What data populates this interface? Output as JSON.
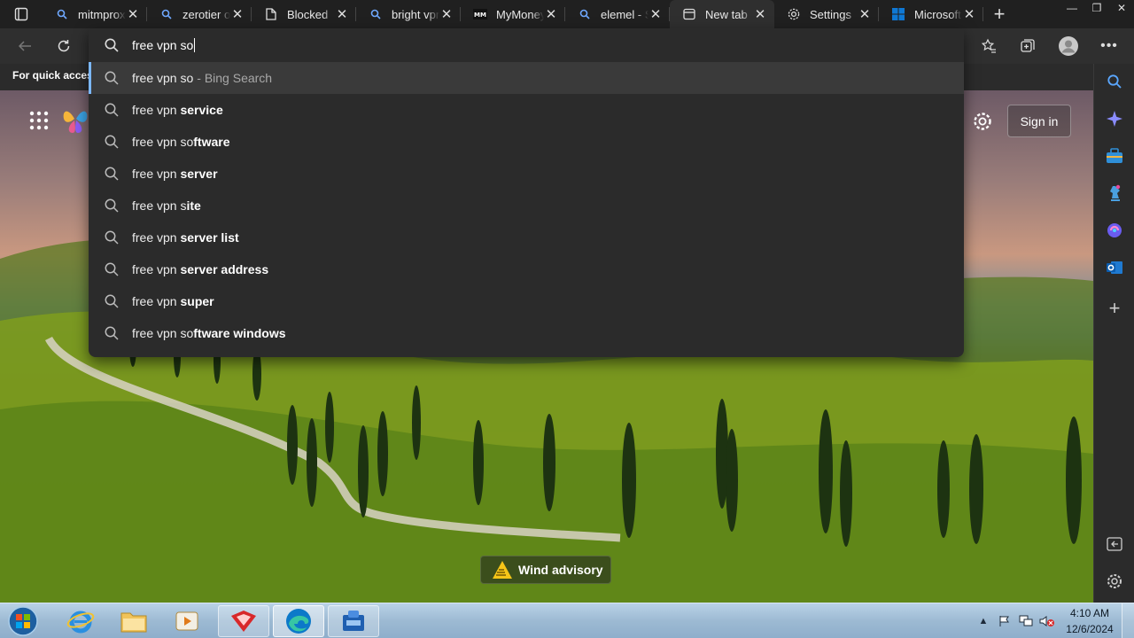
{
  "tabs": [
    {
      "title": "mitmproxy",
      "icon": "search-icon"
    },
    {
      "title": "zerotier one",
      "icon": "search-icon"
    },
    {
      "title": "Blocked",
      "icon": "page-icon"
    },
    {
      "title": "bright vpn",
      "icon": "search-icon"
    },
    {
      "title": "MyMoneyBox",
      "icon": "mymoney-favicon"
    },
    {
      "title": "elemel - Search",
      "icon": "search-icon"
    },
    {
      "title": "New tab",
      "icon": "newtab-icon",
      "active": true
    },
    {
      "title": "Settings",
      "icon": "gear-icon"
    },
    {
      "title": "Microsoft",
      "icon": "microsoft-icon"
    }
  ],
  "toolbar": {
    "address_value": "free vpn so"
  },
  "favorites_bar": {
    "text": "For quick access, place your favorites here on the favorites bar."
  },
  "suggestions": [
    {
      "prefix": "free vpn so",
      "bold": "",
      "meta": "- Bing Search",
      "selected": true
    },
    {
      "prefix": "free vpn ",
      "bold": "service",
      "meta": ""
    },
    {
      "prefix": "free vpn so",
      "bold": "ftware",
      "meta": ""
    },
    {
      "prefix": "free vpn ",
      "bold": "server",
      "meta": ""
    },
    {
      "prefix": "free vpn s",
      "bold": "ite",
      "meta": ""
    },
    {
      "prefix": "free vpn ",
      "bold": "server list",
      "meta": ""
    },
    {
      "prefix": "free vpn ",
      "bold": "server address",
      "meta": ""
    },
    {
      "prefix": "free vpn ",
      "bold": "super",
      "meta": ""
    },
    {
      "prefix": "free vpn so",
      "bold": "ftware windows",
      "meta": ""
    }
  ],
  "newtab": {
    "signin_label": "Sign in",
    "weather_alert": "Wind advisory"
  },
  "taskbar": {
    "time": "4:10 AM",
    "date": "12/6/2024"
  },
  "colors": {
    "accent": "#7bb7ff",
    "chrome_dark": "#202020",
    "toolbar": "#2f2f2f",
    "dropdown": "#2b2b2b"
  }
}
